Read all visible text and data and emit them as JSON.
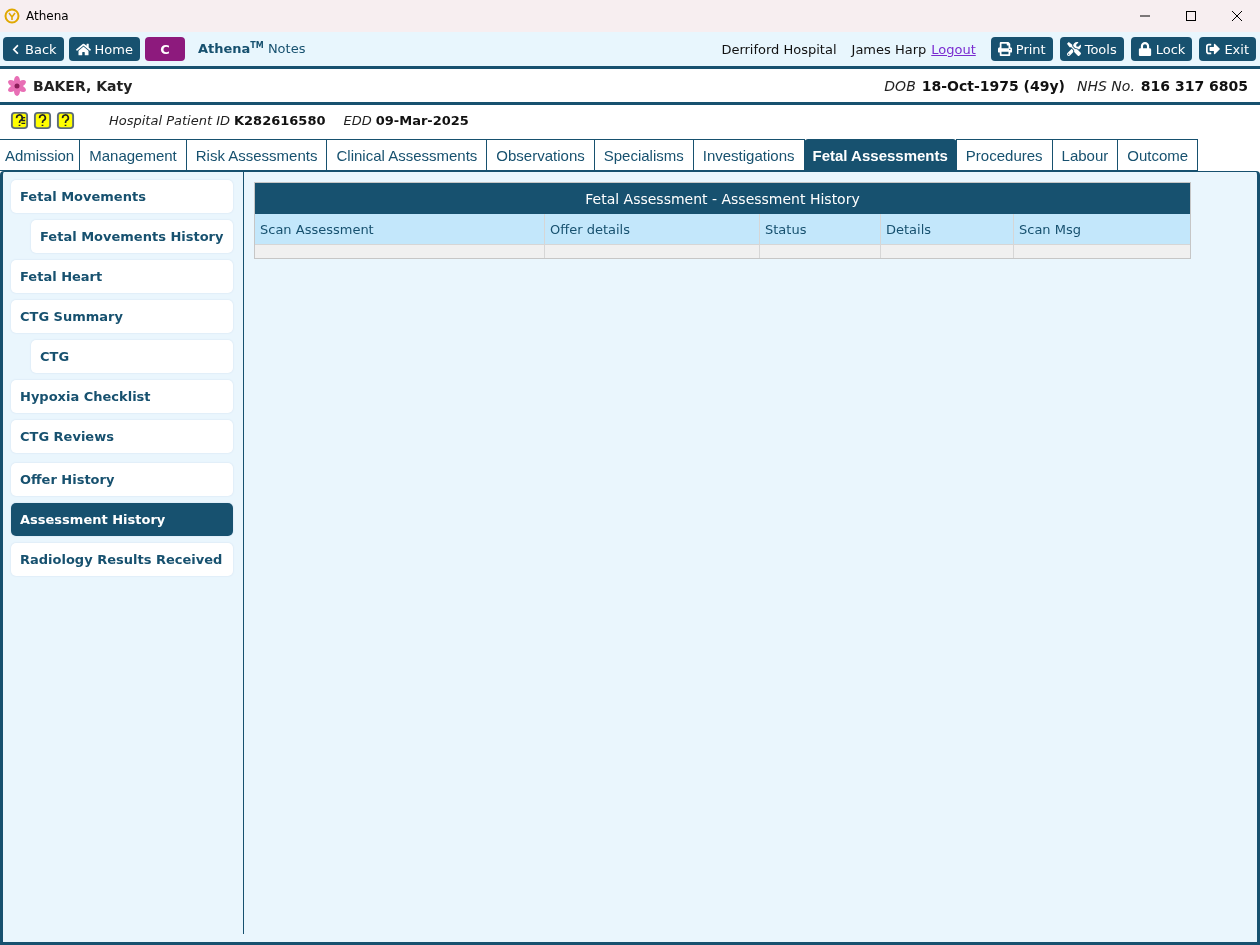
{
  "window": {
    "title": "Athena"
  },
  "toolbar": {
    "back": "Back",
    "home": "Home",
    "badge": "C",
    "app_name": "Athena",
    "app_mark": "TM",
    "app_suffix": "Notes",
    "hospital": "Derriford Hospital",
    "user": "James Harp",
    "logout": "Logout",
    "actions": [
      {
        "kind": "print",
        "label": "Print"
      },
      {
        "kind": "tools",
        "label": "Tools"
      },
      {
        "kind": "lock",
        "label": "Lock"
      },
      {
        "kind": "exit",
        "label": "Exit"
      }
    ]
  },
  "patient": {
    "name": "BAKER, Katy",
    "dob_label": "DOB",
    "dob": "18-Oct-1975 (49y)",
    "nhs_label": "NHS No.",
    "nhs": "816 317 6805"
  },
  "info": {
    "id_label": "Hospital Patient ID",
    "id": "K282616580",
    "edd_label": "EDD",
    "edd": "09-Mar-2025"
  },
  "tabs": [
    {
      "label": "Admission",
      "selected": false
    },
    {
      "label": "Management",
      "selected": false
    },
    {
      "label": "Risk Assessments",
      "selected": false
    },
    {
      "label": "Clinical Assessments",
      "selected": false
    },
    {
      "label": "Observations",
      "selected": false
    },
    {
      "label": "Specialisms",
      "selected": false
    },
    {
      "label": "Investigations",
      "selected": false
    },
    {
      "label": "Fetal Assessments",
      "selected": true
    },
    {
      "label": "Procedures",
      "selected": false
    },
    {
      "label": "Labour",
      "selected": false
    },
    {
      "label": "Outcome",
      "selected": false
    }
  ],
  "sidebar": {
    "groups": [
      [
        {
          "label": "Fetal Movements",
          "selected": false,
          "children": [
            {
              "label": "Fetal Movements History",
              "selected": false
            }
          ]
        },
        {
          "label": "Fetal Heart",
          "selected": false
        },
        {
          "label": "CTG Summary",
          "selected": false,
          "children": [
            {
              "label": "CTG",
              "selected": false
            }
          ]
        },
        {
          "label": "Hypoxia Checklist",
          "selected": false
        },
        {
          "label": "CTG Reviews",
          "selected": false
        }
      ],
      [
        {
          "label": "Offer History",
          "selected": false
        },
        {
          "label": "Assessment History",
          "selected": true
        },
        {
          "label": "Radiology Results Received",
          "selected": false
        }
      ]
    ]
  },
  "table": {
    "title": "Fetal Assessment - Assessment History",
    "columns": [
      "Scan Assessment",
      "Offer details",
      "Status",
      "Details",
      "Scan Msg"
    ]
  }
}
